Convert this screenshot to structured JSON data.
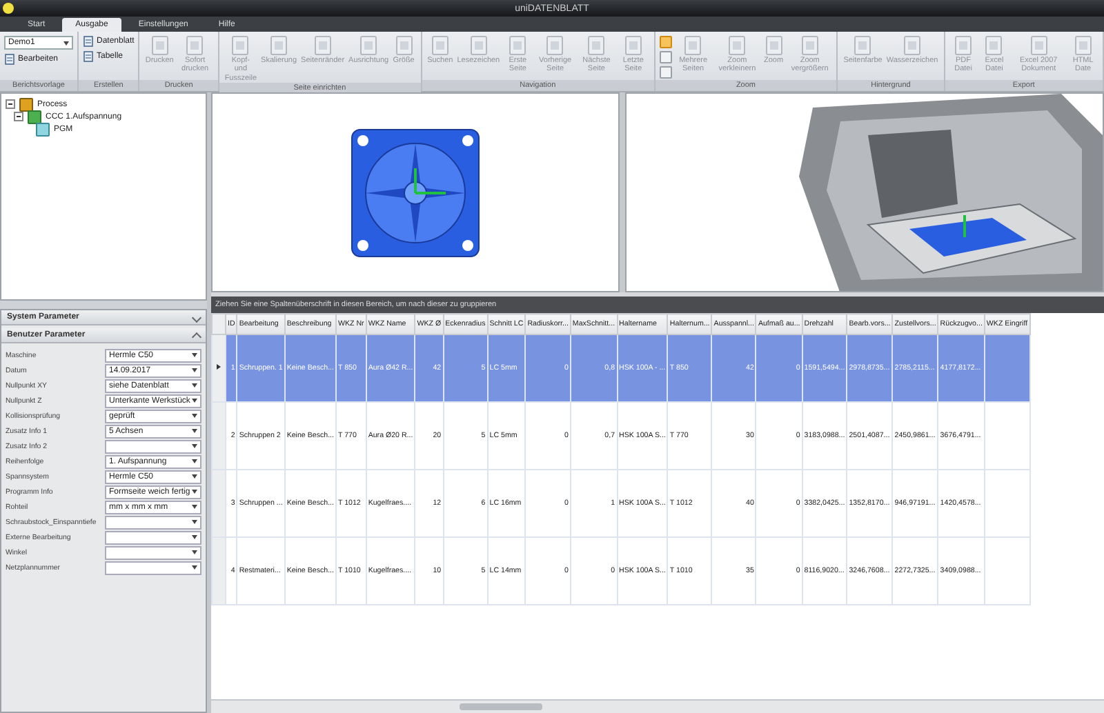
{
  "window": {
    "title": "uniDATENBLATT"
  },
  "tabs": [
    {
      "label": "Start",
      "selected": false
    },
    {
      "label": "Ausgabe",
      "selected": true
    },
    {
      "label": "Einstellungen",
      "selected": false
    },
    {
      "label": "Hilfe",
      "selected": false
    }
  ],
  "ribbon": {
    "groups": [
      {
        "label": "Berichtsvorlage",
        "dropdown": "Demo1",
        "buttons": [
          {
            "label": "Bearbeiten",
            "kind": "small",
            "disabled": false
          }
        ]
      },
      {
        "label": "Erstellen",
        "buttons": [
          {
            "label": "Datenblatt",
            "kind": "small",
            "disabled": false
          },
          {
            "label": "Tabelle",
            "kind": "small",
            "disabled": false
          }
        ]
      },
      {
        "label": "Drucken",
        "buttons": [
          {
            "label": "Drucken",
            "kind": "large",
            "disabled": true
          },
          {
            "label": "Sofort drucken",
            "kind": "large",
            "disabled": true
          }
        ]
      },
      {
        "label": "Seite einrichten",
        "buttons": [
          {
            "label": "Kopf- und Fusszeile",
            "kind": "large",
            "disabled": true
          },
          {
            "label": "Skalierung",
            "kind": "large",
            "disabled": true
          },
          {
            "label": "Seitenränder",
            "kind": "large",
            "disabled": true
          },
          {
            "label": "Ausrichtung",
            "kind": "large",
            "disabled": true
          },
          {
            "label": "Größe",
            "kind": "large",
            "disabled": true
          }
        ]
      },
      {
        "label": "Navigation",
        "buttons": [
          {
            "label": "Suchen",
            "kind": "large",
            "disabled": true
          },
          {
            "label": "Lesezeichen",
            "kind": "large",
            "disabled": true
          },
          {
            "label": "Erste Seite",
            "kind": "large",
            "disabled": true
          },
          {
            "label": "Vorherige Seite",
            "kind": "large",
            "disabled": true
          },
          {
            "label": "Nächste Seite",
            "kind": "large",
            "disabled": true
          },
          {
            "label": "Letzte Seite",
            "kind": "large",
            "disabled": true
          }
        ]
      },
      {
        "label": "Zoom",
        "tools": [
          {
            "selected": true
          },
          {
            "selected": false
          },
          {
            "selected": false
          }
        ],
        "buttons": [
          {
            "label": "Mehrere Seiten",
            "kind": "large",
            "disabled": true
          },
          {
            "label": "Zoom verkleinern",
            "kind": "large",
            "disabled": true
          },
          {
            "label": "Zoom",
            "kind": "large",
            "disabled": true
          },
          {
            "label": "Zoom vergrößern",
            "kind": "large",
            "disabled": true
          }
        ]
      },
      {
        "label": "Hintergrund",
        "buttons": [
          {
            "label": "Seitenfarbe",
            "kind": "large",
            "disabled": true
          },
          {
            "label": "Wasserzeichen",
            "kind": "large",
            "disabled": true
          }
        ]
      },
      {
        "label": "Export",
        "buttons": [
          {
            "label": "PDF Datei",
            "kind": "large",
            "disabled": true
          },
          {
            "label": "Excel Datei",
            "kind": "large",
            "disabled": true
          },
          {
            "label": "Excel 2007 Dokument",
            "kind": "large",
            "disabled": true
          },
          {
            "label": "HTML Date",
            "kind": "large",
            "disabled": true
          }
        ]
      }
    ]
  },
  "tree": {
    "label": "Process",
    "expanded": true,
    "children": [
      {
        "label": "CCC  1.Aufspannung",
        "expanded": true,
        "children": [
          {
            "label": "PGM"
          }
        ]
      }
    ]
  },
  "sections": [
    {
      "title": "System Parameter",
      "expanded": false
    },
    {
      "title": "Benutzer Parameter",
      "expanded": true
    }
  ],
  "parameters": [
    {
      "label": "Maschine",
      "value": "Hermle C50"
    },
    {
      "label": "Datum",
      "value": "14.09.2017"
    },
    {
      "label": "Nullpunkt XY",
      "value": "siehe Datenblatt"
    },
    {
      "label": "Nullpunkt Z",
      "value": "Unterkante Werkstück"
    },
    {
      "label": "Kollisionsprüfung",
      "value": "geprüft"
    },
    {
      "label": "Zusatz Info 1",
      "value": "5 Achsen"
    },
    {
      "label": "Zusatz Info 2"
    },
    {
      "label": "Reihenfolge",
      "value": "1. Aufspannung"
    },
    {
      "label": "Spannsystem",
      "value": "Hermle C50"
    },
    {
      "label": "Programm Info",
      "value": "Formseite weich fertig"
    },
    {
      "label": "Rohteil",
      "value": "mm x  mm x mm"
    },
    {
      "label": "Schraubstock_Einspanntiefe"
    },
    {
      "label": "Externe Bearbeitung"
    },
    {
      "label": "Winkel"
    },
    {
      "label": "Netzplannummer"
    }
  ],
  "table": {
    "group_hint": "Ziehen Sie eine Spaltenüberschrift in diesen Bereich, um nach dieser zu gruppieren",
    "columns": [
      {
        "label": "ID",
        "kind": "number"
      },
      {
        "label": "Bearbeitung",
        "kind": "text"
      },
      {
        "label": "Beschreibung",
        "kind": "text"
      },
      {
        "label": "WKZ Nr",
        "kind": "text"
      },
      {
        "label": "WKZ Name",
        "kind": "text"
      },
      {
        "label": "WKZ Ø",
        "kind": "number"
      },
      {
        "label": "Eckenradius",
        "kind": "number"
      },
      {
        "label": "Schnitt LC",
        "kind": "text"
      },
      {
        "label": "Radiuskorr...",
        "kind": "number"
      },
      {
        "label": "MaxSchnitt...",
        "kind": "number"
      },
      {
        "label": "Haltername",
        "kind": "text"
      },
      {
        "label": "Halternum...",
        "kind": "text"
      },
      {
        "label": "Ausspannl...",
        "kind": "number"
      },
      {
        "label": "Aufmaß au...",
        "kind": "number"
      },
      {
        "label": "Drehzahl",
        "kind": "text"
      },
      {
        "label": "Bearb.vors...",
        "kind": "text"
      },
      {
        "label": "Zustellvors...",
        "kind": "text"
      },
      {
        "label": "Rückzugvo...",
        "kind": "text"
      },
      {
        "label": "WKZ Eingriff",
        "kind": "text"
      }
    ],
    "rows": [
      {
        "selected": true,
        "cells": [
          "1",
          "Schruppen. 1",
          "Keine Besch...",
          "T 850",
          "Aura Ø42 R...",
          "42",
          "5",
          "LC 5mm",
          "0",
          "0,8",
          "HSK 100A - ...",
          "T 850",
          "42",
          "0",
          "1591,5494...",
          "2978,8735...",
          "2785,2115...",
          "4177,8172..."
        ]
      },
      {
        "selected": false,
        "cells": [
          "2",
          "Schruppen 2",
          "Keine Besch...",
          "T 770",
          "Aura Ø20 R...",
          "20",
          "5",
          "LC 5mm",
          "0",
          "0,7",
          "HSK 100A S...",
          "T 770",
          "30",
          "0",
          "3183,0988...",
          "2501,4087...",
          "2450,9861...",
          "3676,4791..."
        ]
      },
      {
        "selected": false,
        "cells": [
          "3",
          "Schruppen ...",
          "Keine Besch...",
          "T 1012",
          "Kugelfraes....",
          "12",
          "6",
          "LC 16mm",
          "0",
          "1",
          "HSK 100A S...",
          "T 1012",
          "40",
          "0",
          "3382,0425...",
          "1352,8170...",
          "946,97191...",
          "1420,4578..."
        ]
      },
      {
        "selected": false,
        "cells": [
          "4",
          "Restmateri...",
          "Keine Besch...",
          "T 1010",
          "Kugelfraes....",
          "10",
          "5",
          "LC 14mm",
          "0",
          "0",
          "HSK 100A S...",
          "T 1010",
          "35",
          "0",
          "8116,9020...",
          "3246,7608...",
          "2272,7325...",
          "3409,0988..."
        ]
      }
    ]
  }
}
